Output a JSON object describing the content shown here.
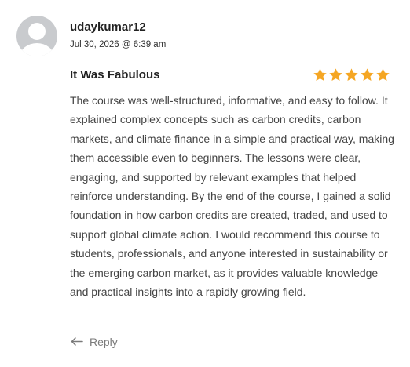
{
  "review": {
    "username": "udaykumar12",
    "date": "Jul 30, 2026 @ 6:39 am",
    "title": "It Was Fabulous",
    "rating": 5,
    "rating_max": 5,
    "star_color": "#f5a623",
    "body": "The course was well-structured, informative, and easy to follow. It explained complex concepts such as carbon credits, carbon markets, and climate finance in a simple and practical way, making them accessible even to beginners. The lessons were clear, engaging, and supported by relevant examples that helped reinforce understanding. By the end of the course, I gained a solid foundation in how carbon credits are created, traded, and used to support global climate action. I would recommend this course to students, professionals, and anyone interested in sustainability or the emerging carbon market, as it provides valuable knowledge and practical insights into a rapidly growing field."
  },
  "actions": {
    "reply_label": "Reply",
    "reply_icon": "reply-arrow-icon"
  },
  "avatar": {
    "icon": "default-user-avatar-icon"
  }
}
